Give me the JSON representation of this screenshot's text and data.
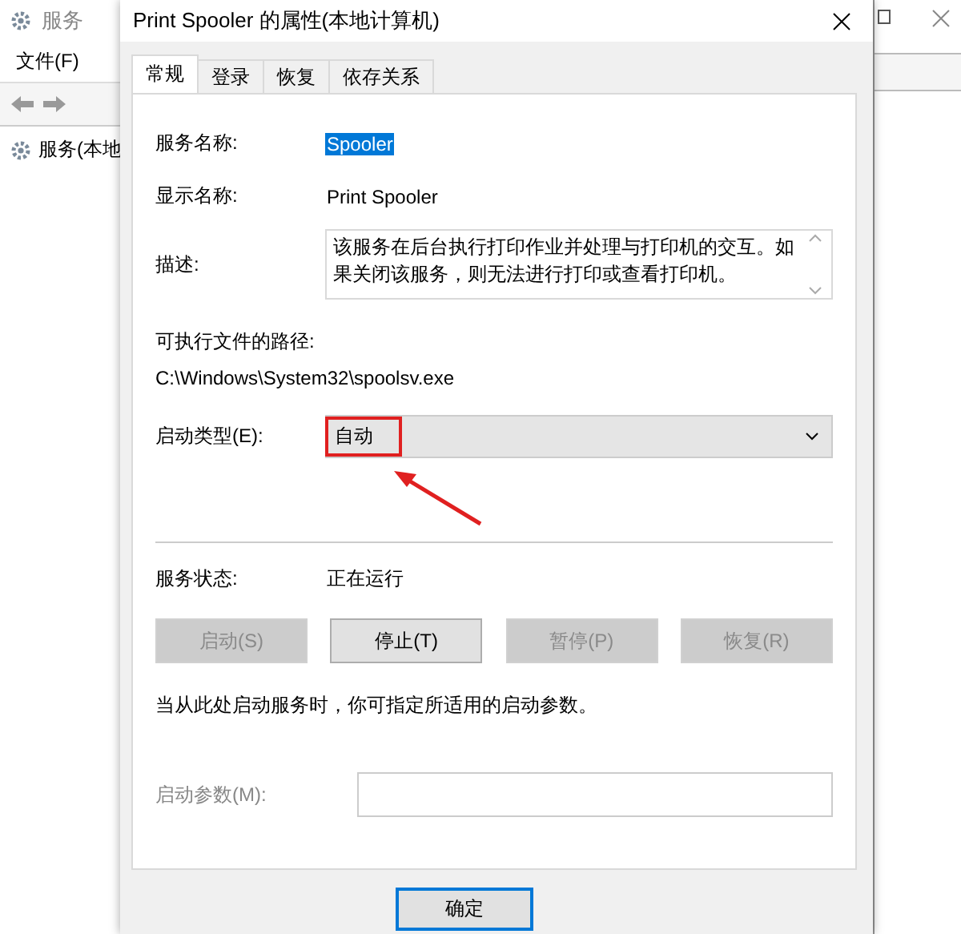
{
  "background_window": {
    "title": "服务",
    "menu": [
      "文件(F)"
    ],
    "tree_item": "服务(本地"
  },
  "dialog": {
    "title": "Print Spooler 的属性(本地计算机)",
    "tabs": [
      {
        "label": "常规",
        "selected": true
      },
      {
        "label": "登录",
        "selected": false
      },
      {
        "label": "恢复",
        "selected": false
      },
      {
        "label": "依存关系",
        "selected": false
      }
    ],
    "service_name": {
      "label": "服务名称:",
      "value": "Spooler",
      "selected": true
    },
    "display_name": {
      "label": "显示名称:",
      "value": "Print Spooler"
    },
    "description": {
      "label": "描述:",
      "value": "该服务在后台执行打印作业并处理与打印机的交互。如果关闭该服务，则无法进行打印或查看打印机。"
    },
    "path": {
      "label": "可执行文件的路径:",
      "value": "C:\\Windows\\System32\\spoolsv.exe"
    },
    "startup_type": {
      "label": "启动类型(E):",
      "value": "自动",
      "highlighted": true
    },
    "status": {
      "label": "服务状态:",
      "value": "正在运行"
    },
    "buttons": [
      {
        "label": "启动(S)",
        "disabled": true
      },
      {
        "label": "停止(T)",
        "disabled": false
      },
      {
        "label": "暂停(P)",
        "disabled": true
      },
      {
        "label": "恢复(R)",
        "disabled": true
      }
    ],
    "hint": "当从此处启动服务时，你可指定所适用的启动参数。",
    "start_params": {
      "label": "启动参数(M):",
      "disabled": true
    },
    "ok_button": "确定"
  }
}
